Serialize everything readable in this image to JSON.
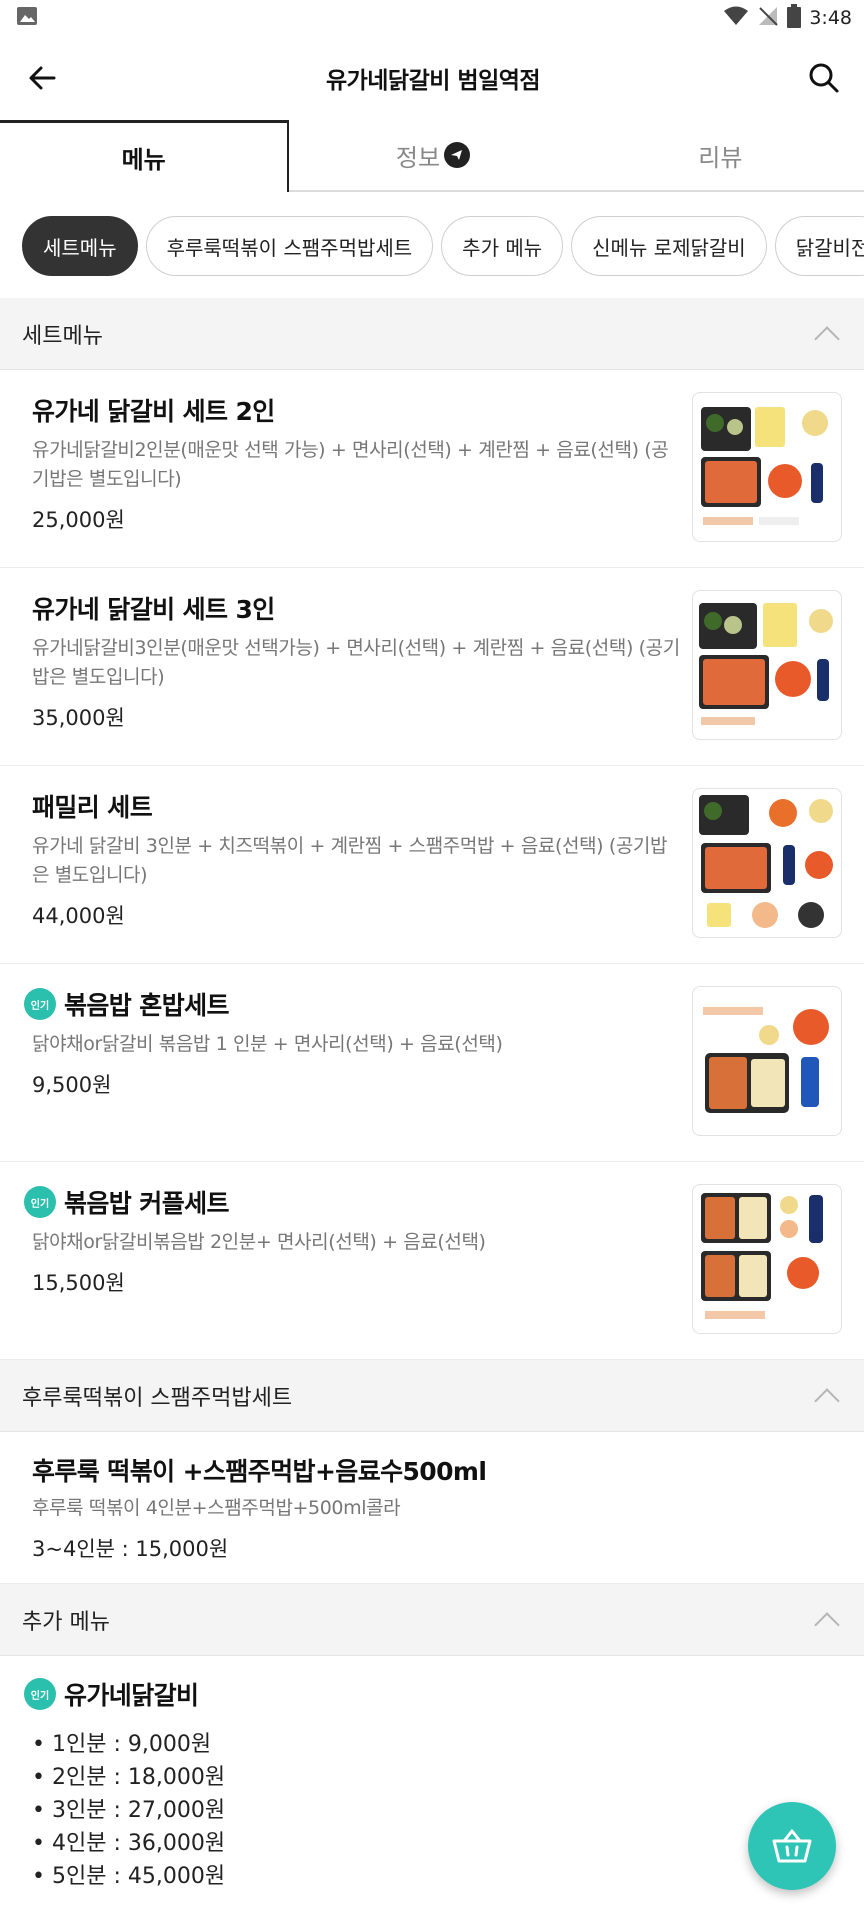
{
  "status_bar": {
    "time": "3:48"
  },
  "header": {
    "title": "유가네닭갈비 범일역점"
  },
  "tabs": [
    {
      "label": "메뉴"
    },
    {
      "label": "정보"
    },
    {
      "label": "리뷰"
    }
  ],
  "chips": [
    {
      "label": "세트메뉴"
    },
    {
      "label": "후루룩떡볶이 스팸주먹밥세트"
    },
    {
      "label": "추가 메뉴"
    },
    {
      "label": "신메뉴 로제닭갈비"
    },
    {
      "label": "닭갈비전"
    }
  ],
  "sections": {
    "set_menu": {
      "title": "세트메뉴",
      "items": [
        {
          "title": "유가네 닭갈비 세트 2인",
          "desc": "유가네닭갈비2인분(매운맛 선택 가능) + 면사리(선택) + 계란찜 + 음료(선택) (공기밥은 별도입니다)",
          "price": "25,000원"
        },
        {
          "title": "유가네 닭갈비 세트 3인",
          "desc": "유가네닭갈비3인분(매운맛 선택가능) + 면사리(선택) + 계란찜 + 음료(선택) (공기밥은 별도입니다)",
          "price": "35,000원"
        },
        {
          "title": "패밀리 세트",
          "desc": "유가네 닭갈비 3인분 + 치즈떡볶이 + 계란찜 + 스팸주먹밥 + 음료(선택) (공기밥은 별도입니다)",
          "price": "44,000원"
        },
        {
          "badge": "인기",
          "title": "볶음밥 혼밥세트",
          "desc": "닭야채or닭갈비 볶음밥 1 인분 + 면사리(선택) + 음료(선택)",
          "price": "9,500원"
        },
        {
          "badge": "인기",
          "title": "볶음밥 커플세트",
          "desc": "닭야채or닭갈비볶음밥 2인분+ 면사리(선택) + 음료(선택)",
          "price": "15,500원"
        }
      ]
    },
    "tteok_set": {
      "title": "후루룩떡볶이 스팸주먹밥세트",
      "item": {
        "title": "후루룩 떡볶이 +스팸주먹밥+음료수500ml",
        "desc": "후루룩 떡볶이 4인분+스팸주먹밥+500ml콜라",
        "price": "3~4인분 : 15,000원"
      }
    },
    "extra_menu": {
      "title": "추가 메뉴",
      "item": {
        "badge": "인기",
        "title": "유가네닭갈비",
        "prices": [
          "1인분 : 9,000원",
          "2인분 : 18,000원",
          "3인분 : 27,000원",
          "4인분 : 36,000원",
          "5인분 : 45,000원"
        ]
      }
    }
  },
  "colors": {
    "accent": "#2ec4b6",
    "chip_selected": "#333333"
  }
}
